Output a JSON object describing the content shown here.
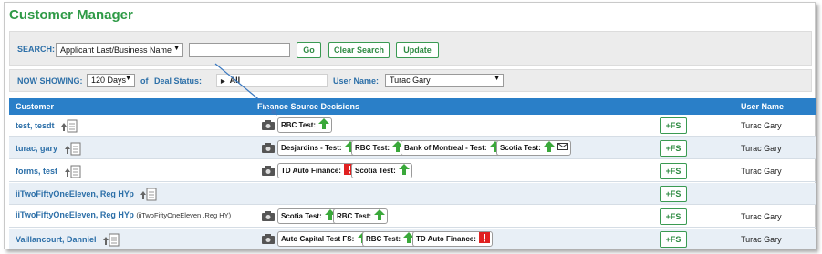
{
  "title": "Customer Manager",
  "search": {
    "label": "SEARCH:",
    "type_selected": "Applicant Last/Business Name",
    "query_value": "",
    "go_label": "Go",
    "clear_label": "Clear Search",
    "update_label": "Update"
  },
  "showing": {
    "label": "NOW SHOWING:",
    "period": "120 Days",
    "of": "of",
    "deal_status_label": "Deal Status:",
    "deal_status_value": "All",
    "user_name_label": "User Name:",
    "user_name_value": "Turac Gary"
  },
  "table": {
    "headers": {
      "customer": "Customer",
      "decisions": "Finance Source Decisions",
      "user": "User Name"
    },
    "add_fs_label": "+FS",
    "rows": [
      {
        "name": "test, tesdt",
        "user": "Turac Gary"
      },
      {
        "name": "turac, gary",
        "user": "Turac Gary"
      },
      {
        "name": "forms, test",
        "user": "Turac Gary"
      },
      {
        "name": "iiTwoFiftyOneEleven, Reg HYp",
        "user": ""
      },
      {
        "name": "iiTwoFiftyOneEleven, Reg HYp",
        "sub": "(iiTwoFiftyOneEleven ,Reg HY)",
        "user": "Turac Gary"
      },
      {
        "name": "Vaillancourt, Danniel",
        "user": "Turac Gary"
      }
    ],
    "decisions": {
      "r0": [
        "RBC Test:"
      ],
      "r1": [
        "Desjardins - Test:",
        "RBC Test:",
        "Bank of Montreal - Test:",
        "Scotia Test:"
      ],
      "r2": [
        "TD Auto Finance:",
        "Scotia Test:"
      ],
      "r4": [
        "Scotia Test:",
        "RBC Test:"
      ],
      "r5": [
        "Auto Capital Test FS:",
        "RBC Test:",
        "TD Auto Finance:"
      ]
    }
  },
  "colors": {
    "title_green": "#2e9a46",
    "header_blue": "#2a7fc8",
    "link_blue": "#2c6fa8",
    "approved_green": "#3aa83a",
    "declined_red": "#e02020"
  },
  "icons": {
    "document": "document-up-arrow-icon",
    "camera": "camera-icon",
    "approved": "green-up-arrow-icon",
    "declined": "red-exclamation-icon",
    "message": "message-icon"
  }
}
